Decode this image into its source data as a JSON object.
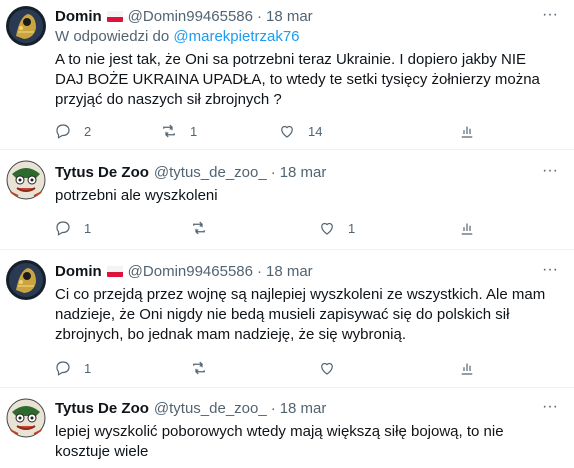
{
  "tweets": [
    {
      "author_name": "Domin",
      "handle": "@Domin99465586",
      "sep": "·",
      "date": "18 mar",
      "reply_prefix": "W odpowiedzi do",
      "reply_mention": "@marekpietrzak76",
      "text": "A to nie jest tak, że Oni sa potrzebni teraz Ukrainie. I dopiero jakby NIE DAJ BOŻE UKRAINA UPADŁA, to wtedy te setki tysięcy żołnierzy można przyjąć do naszych sił zbrojnych ?",
      "replies": "2",
      "retweets": "1",
      "likes": "14"
    },
    {
      "author_name": "Tytus De Zoo",
      "handle": "@tytus_de_zoo_",
      "sep": "·",
      "date": "18 mar",
      "text": "potrzebni ale wyszkoleni",
      "replies": "1",
      "retweets": "",
      "likes": "1"
    },
    {
      "author_name": "Domin",
      "handle": "@Domin99465586",
      "sep": "·",
      "date": "18 mar",
      "text": "Ci co przejdą przez wojnę są najlepiej wyszkoleni ze wszystkich. Ale mam nadzieje, że Oni nigdy nie bedą musieli zapisywać się do polskich sił zbrojnych, bo jednak mam nadzieję, że się wybronią.",
      "replies": "1",
      "retweets": "",
      "likes": ""
    },
    {
      "author_name": "Tytus De Zoo",
      "handle": "@tytus_de_zoo_",
      "sep": "·",
      "date": "18 mar",
      "text": "lepiej wyszkolić poborowych wtedy mają większą siłę bojową, to nie kosztuje wiele"
    }
  ],
  "more_label": "···",
  "colors": {
    "text": "#0f1419",
    "secondary": "#536471",
    "link": "#1d9bf0",
    "flag_red": "#dc143c"
  },
  "icons": [
    "reply-icon",
    "retweet-icon",
    "like-icon",
    "share-icon",
    "more-icon",
    "poland-flag-icon"
  ]
}
